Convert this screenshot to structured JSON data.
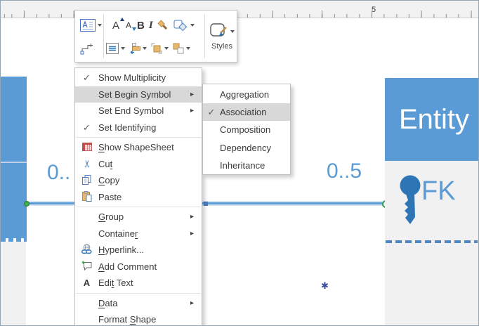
{
  "ruler": {
    "label": "5"
  },
  "toolbar": {
    "styles_label": "Styles",
    "icon_names": [
      "text-block",
      "grow-font",
      "shrink-font",
      "bold",
      "italic",
      "format-painter",
      "change-shape",
      "styles",
      "connector",
      "text-align",
      "position",
      "bring-forward",
      "send-backward"
    ]
  },
  "menu": {
    "items": [
      {
        "type": "item",
        "label_pre": "Show Multiplicity",
        "label_underline": "",
        "label_post": "",
        "checked": true,
        "has_submenu": false,
        "highlighted": false,
        "icon": ""
      },
      {
        "type": "item",
        "label_pre": "Set Begin Symbol",
        "label_underline": "",
        "label_post": "",
        "checked": false,
        "has_submenu": true,
        "highlighted": true,
        "icon": ""
      },
      {
        "type": "item",
        "label_pre": "Set End Symbol",
        "label_underline": "",
        "label_post": "",
        "checked": false,
        "has_submenu": true,
        "highlighted": false,
        "icon": ""
      },
      {
        "type": "item",
        "label_pre": "Set Identifying",
        "label_underline": "",
        "label_post": "",
        "checked": true,
        "has_submenu": false,
        "highlighted": false,
        "icon": ""
      },
      {
        "type": "separator"
      },
      {
        "type": "item",
        "label_pre": "",
        "label_underline": "S",
        "label_post": "how ShapeSheet",
        "checked": false,
        "has_submenu": false,
        "highlighted": false,
        "icon": "shapesheet"
      },
      {
        "type": "item",
        "label_pre": "Cu",
        "label_underline": "t",
        "label_post": "",
        "checked": false,
        "has_submenu": false,
        "highlighted": false,
        "icon": "cut"
      },
      {
        "type": "item",
        "label_pre": "",
        "label_underline": "C",
        "label_post": "opy",
        "checked": false,
        "has_submenu": false,
        "highlighted": false,
        "icon": "copy"
      },
      {
        "type": "item",
        "label_pre": "Paste",
        "label_underline": "",
        "label_post": "",
        "checked": false,
        "has_submenu": false,
        "highlighted": false,
        "icon": "paste"
      },
      {
        "type": "separator"
      },
      {
        "type": "item",
        "label_pre": "",
        "label_underline": "G",
        "label_post": "roup",
        "checked": false,
        "has_submenu": true,
        "highlighted": false,
        "icon": ""
      },
      {
        "type": "item",
        "label_pre": "Containe",
        "label_underline": "r",
        "label_post": "",
        "checked": false,
        "has_submenu": true,
        "highlighted": false,
        "icon": ""
      },
      {
        "type": "item",
        "label_pre": "",
        "label_underline": "H",
        "label_post": "yperlink...",
        "checked": false,
        "has_submenu": false,
        "highlighted": false,
        "icon": "hyperlink"
      },
      {
        "type": "item",
        "label_pre": "",
        "label_underline": "A",
        "label_post": "dd Comment",
        "checked": false,
        "has_submenu": false,
        "highlighted": false,
        "icon": "add-comment"
      },
      {
        "type": "item",
        "label_pre": "Edi",
        "label_underline": "t",
        "label_post": " Text",
        "checked": false,
        "has_submenu": false,
        "highlighted": false,
        "icon": "edit-text"
      },
      {
        "type": "separator"
      },
      {
        "type": "item",
        "label_pre": "",
        "label_underline": "D",
        "label_post": "ata",
        "checked": false,
        "has_submenu": true,
        "highlighted": false,
        "icon": ""
      },
      {
        "type": "item",
        "label_pre": "Format ",
        "label_underline": "S",
        "label_post": "hape",
        "checked": false,
        "has_submenu": false,
        "highlighted": false,
        "icon": ""
      }
    ]
  },
  "submenu": {
    "items": [
      {
        "label": "Aggregation",
        "checked": false,
        "highlighted": false
      },
      {
        "label": "Association",
        "checked": true,
        "highlighted": true
      },
      {
        "label": "Composition",
        "checked": false,
        "highlighted": false
      },
      {
        "label": "Dependency",
        "checked": false,
        "highlighted": false
      },
      {
        "label": "Inheritance",
        "checked": false,
        "highlighted": false
      }
    ]
  },
  "diagram": {
    "entity_title": "Entity",
    "fk_label": "FK",
    "multiplicity_left": "0..",
    "multiplicity_right": "0..5"
  },
  "icons": {
    "checkmark": "✓",
    "submenu_arrow": "▸",
    "cut_glyph": "✂",
    "edit_text_glyph": "A",
    "canvas_badge": "✱"
  },
  "colors": {
    "accent_blue": "#5b9bd5",
    "key_blue": "#2e75b6",
    "dash_blue": "#4e86c6",
    "handle_green": "#3fae49",
    "menu_highlight": "#d8d8d8"
  }
}
